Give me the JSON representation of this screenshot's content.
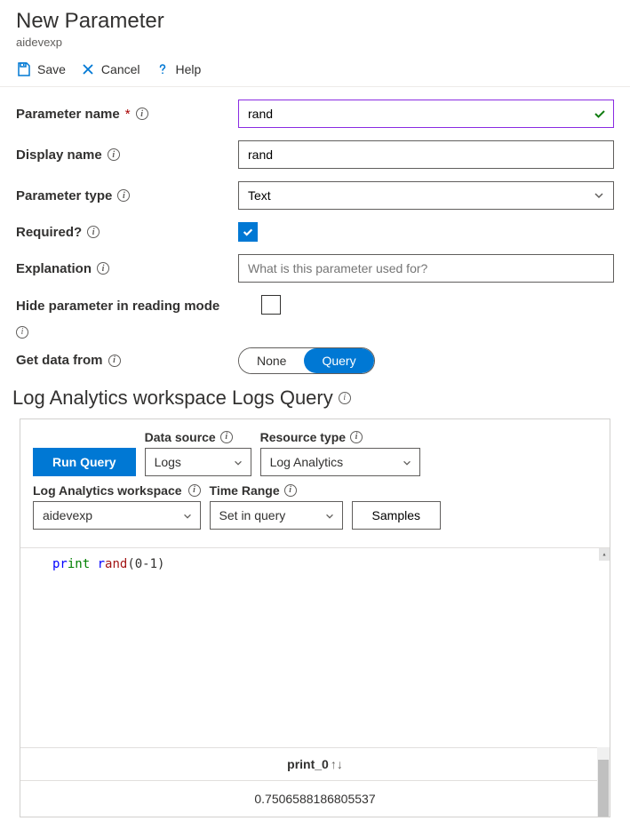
{
  "header": {
    "title": "New Parameter",
    "subtitle": "aidevexp"
  },
  "toolbar": {
    "save": "Save",
    "cancel": "Cancel",
    "help": "Help"
  },
  "form": {
    "param_name_label": "Parameter name",
    "param_name_value": "rand",
    "display_name_label": "Display name",
    "display_name_value": "rand",
    "param_type_label": "Parameter type",
    "param_type_value": "Text",
    "required_label": "Required?",
    "required_checked": true,
    "explanation_label": "Explanation",
    "explanation_placeholder": "What is this parameter used for?",
    "hide_label": "Hide parameter in reading mode",
    "hide_checked": false,
    "get_data_label": "Get data from",
    "pill_none": "None",
    "pill_query": "Query"
  },
  "section": {
    "title": "Log Analytics workspace Logs Query"
  },
  "query_panel": {
    "run_button": "Run Query",
    "data_source_label": "Data source",
    "data_source_value": "Logs",
    "resource_type_label": "Resource type",
    "resource_type_value": "Log Analytics",
    "workspace_label": "Log Analytics workspace",
    "workspace_value": "aidevexp",
    "time_range_label": "Time Range",
    "time_range_value": "Set in query",
    "samples_button": "Samples"
  },
  "editor": {
    "tok_pr": "pr",
    "tok_int": "int",
    "tok_r": "r",
    "tok_and": "and",
    "tok_paren": "(0-1)"
  },
  "results": {
    "column_header": "print_0",
    "sort_arrows": "↑↓",
    "value": "0.7506588186805537"
  }
}
